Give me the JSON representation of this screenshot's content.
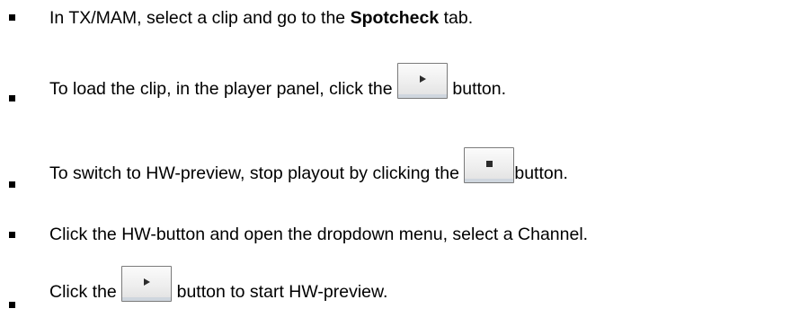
{
  "steps": [
    {
      "before": "In TX/MAM, select a clip and go to the ",
      "bold": "Spotcheck",
      "after": " tab."
    },
    {
      "before": "To load the clip, in the player panel, click the ",
      "button_icon": "play-icon",
      "after": " button."
    },
    {
      "before": "To switch to HW-preview, stop playout by clicking the ",
      "button_icon": "stop-icon",
      "after": "button."
    },
    {
      "text": "Click the HW-button and open the dropdown menu, select a Channel."
    },
    {
      "before": "Click the ",
      "button_icon": "play-icon",
      "after": " button to start HW-preview."
    }
  ]
}
